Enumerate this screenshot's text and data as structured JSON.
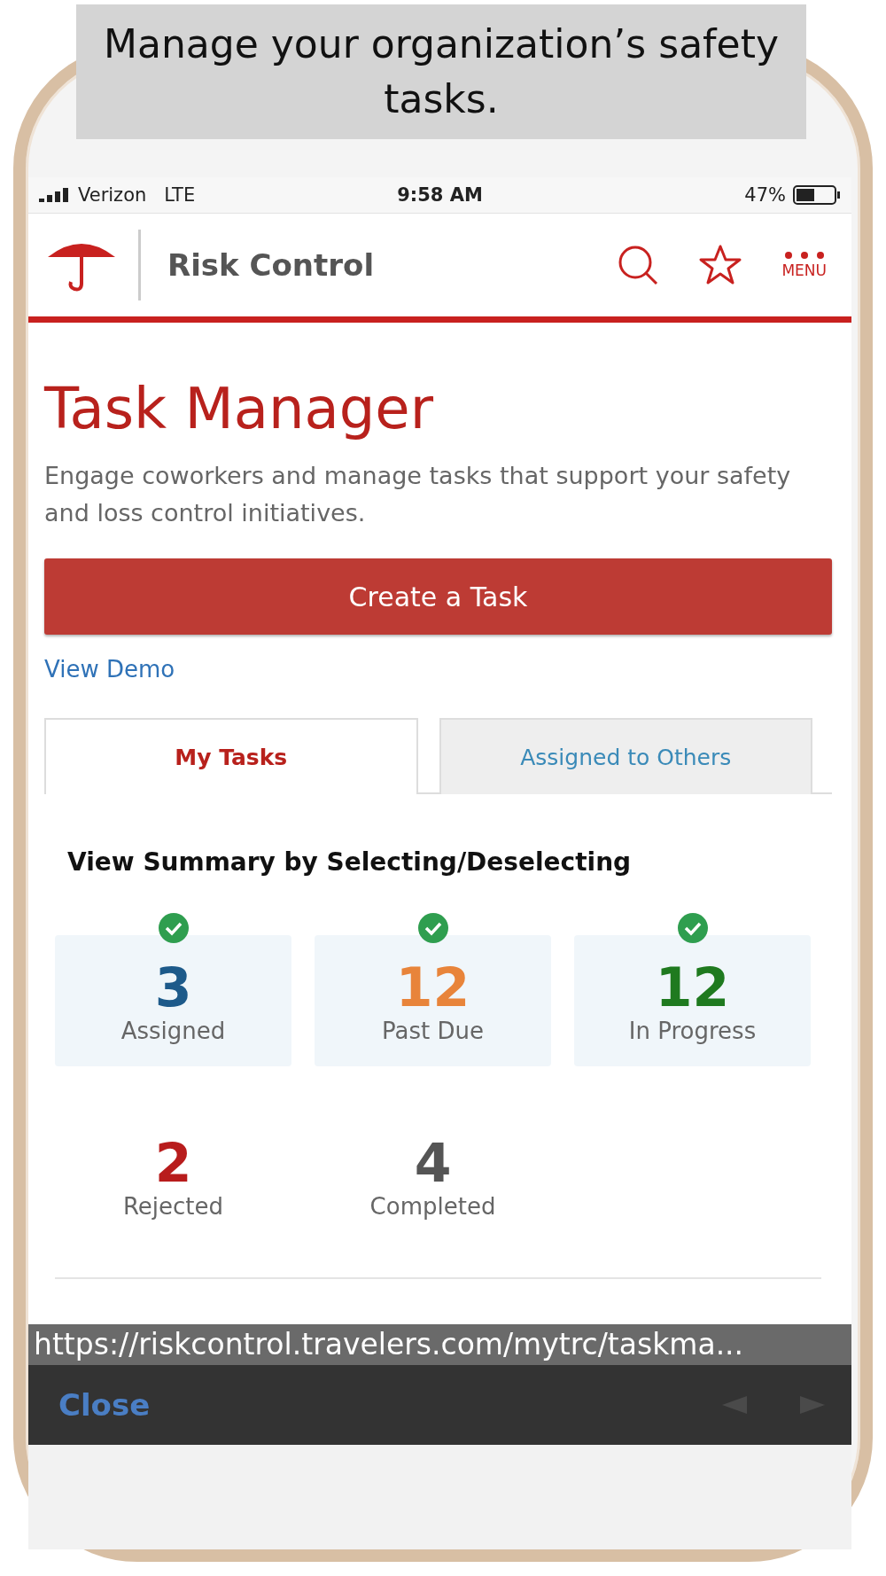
{
  "caption": "Manage your organization’s safety tasks.",
  "status_bar": {
    "carrier": "Verizon",
    "network": "LTE",
    "time": "9:58 AM",
    "battery": "47%"
  },
  "header": {
    "title": "Risk Control",
    "menu_label": "MENU"
  },
  "page": {
    "title": "Task Manager",
    "description": "Engage coworkers and manage tasks that support your safety and loss control initiatives.",
    "create_button": "Create a Task",
    "demo_link": "View Demo"
  },
  "tabs": [
    {
      "label": "My Tasks",
      "selected": true
    },
    {
      "label": "Assigned to Others",
      "selected": false
    }
  ],
  "summary": {
    "heading": "View Summary by Selecting/Deselecting",
    "tiles": [
      {
        "count": "3",
        "label": "Assigned",
        "selected": true,
        "color": "#1d5a8a"
      },
      {
        "count": "12",
        "label": "Past Due",
        "selected": true,
        "color": "#e8843a"
      },
      {
        "count": "12",
        "label": "In Progress",
        "selected": true,
        "color": "#1f7a1f"
      },
      {
        "count": "2",
        "label": "Rejected",
        "selected": false,
        "color": "#b81c1c"
      },
      {
        "count": "4",
        "label": "Completed",
        "selected": false,
        "color": "#555555"
      }
    ]
  },
  "browser_bar": {
    "url": "https://riskcontrol.travelers.com/mytrc/taskma...",
    "close": "Close"
  }
}
